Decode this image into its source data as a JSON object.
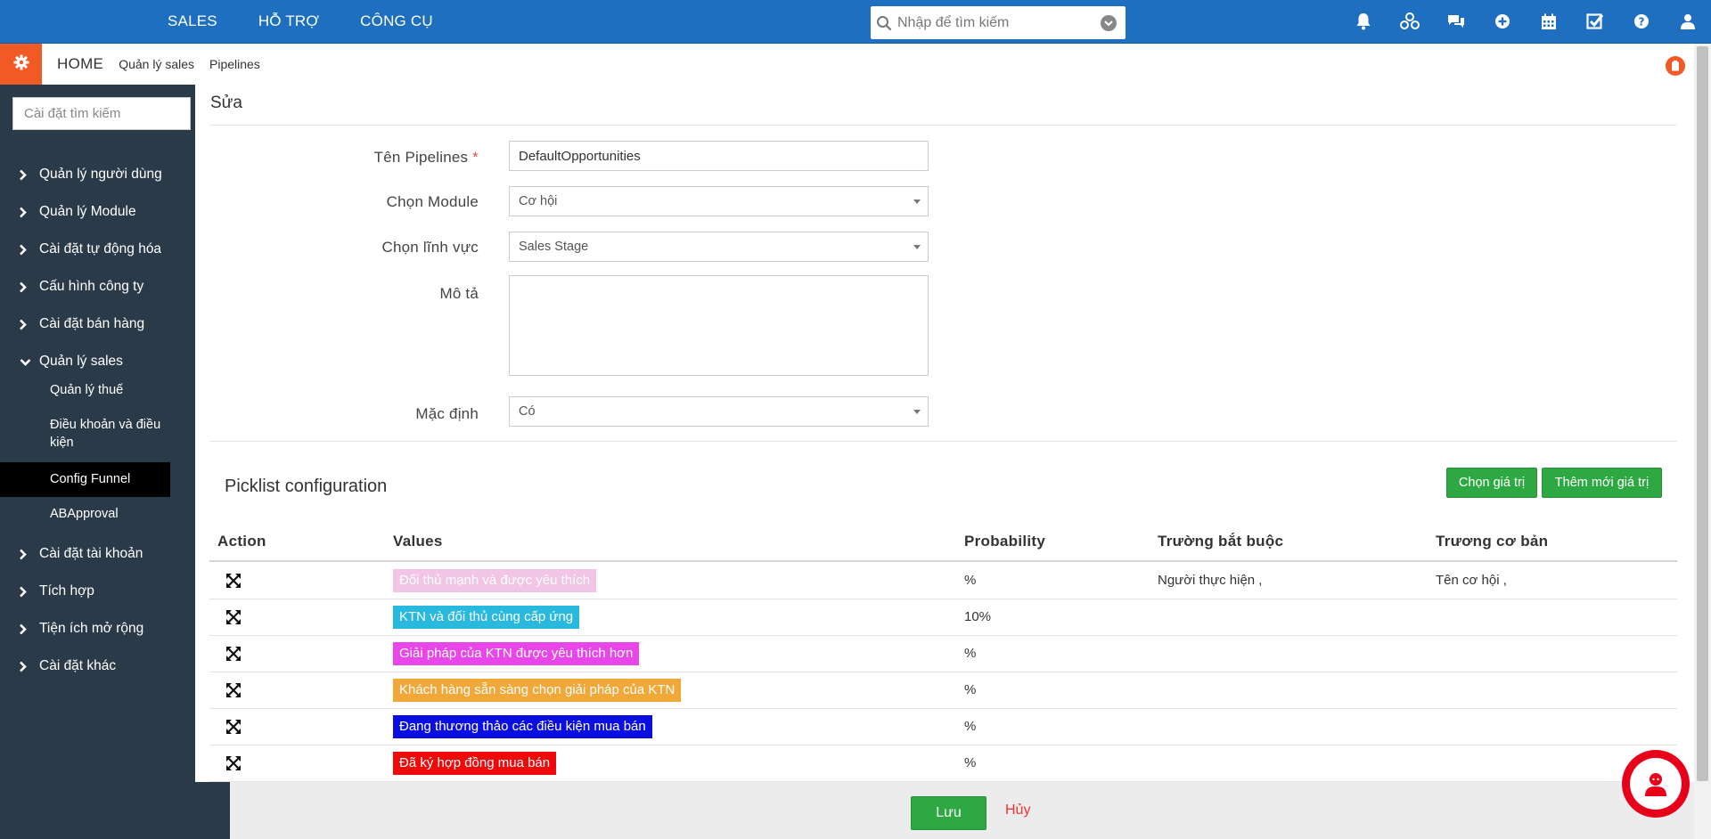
{
  "topnav": {
    "menu": [
      "SALES",
      "HỖ TRỢ",
      "CÔNG CỤ"
    ],
    "search_placeholder": "Nhập để tìm kiếm",
    "icons": [
      "bell-icon",
      "network-icon",
      "chat-icon",
      "plus-circle-icon",
      "calendar-icon",
      "checkbox-icon",
      "help-icon",
      "user-icon"
    ]
  },
  "breadcrumb": {
    "home": "HOME",
    "items": [
      "Quản lý sales",
      "Pipelines"
    ]
  },
  "sidebar": {
    "search_placeholder": "Cài đặt tìm kiếm",
    "items": [
      "Quản lý người dùng",
      "Quản lý Module",
      "Cài đặt tự động hóa",
      "Cấu hình công ty",
      "Cài đặt bán hàng",
      "Quản lý sales",
      "Cài đặt tài khoản",
      "Tích hợp",
      "Tiện ích mở rộng",
      "Cài đặt khác"
    ],
    "sub_items": [
      "Quản lý thuế",
      "Điều khoản và điều kiện",
      "Config Funnel",
      "ABApproval"
    ],
    "active_sub": "Config Funnel"
  },
  "form": {
    "title": "Sửa",
    "name_label": "Tên Pipelines",
    "required_mark": "*",
    "name_value": "DefaultOpportunities",
    "module_label": "Chọn Module",
    "module_value": "Cơ hội",
    "field_label": "Chọn lĩnh vực",
    "field_value": "Sales Stage",
    "desc_label": "Mô tả",
    "desc_value": "",
    "default_label": "Mặc định",
    "default_value": "Có"
  },
  "picklist": {
    "title": "Picklist configuration",
    "choose_button": "Chọn giá trị",
    "add_button": "Thêm mới giá trị",
    "headers": [
      "Action",
      "Values",
      "Probability",
      "Trường bắt buộc",
      "Trương cơ bản"
    ],
    "rows": [
      {
        "value": "Đối thủ mạnh và được yêu thích",
        "color": "#f2c4e6",
        "probability": "%",
        "required": "Người thực hiện ,",
        "basic": "Tên cơ hội ,"
      },
      {
        "value": "KTN và đối thủ cùng cấp ứng",
        "color": "#29b8de",
        "probability": "10%",
        "required": "",
        "basic": ""
      },
      {
        "value": "Giải pháp của KTN được yêu thích hơn",
        "color": "#e846e8",
        "probability": "%",
        "required": "",
        "basic": ""
      },
      {
        "value": "Khách hàng sẵn sàng chọn giải pháp của KTN",
        "color": "#f2a838",
        "probability": "%",
        "required": "",
        "basic": ""
      },
      {
        "value": "Đang thương thảo các điều kiện mua bán",
        "color": "#0a0ee0",
        "probability": "%",
        "required": "",
        "basic": ""
      },
      {
        "value": "Đã ký hợp đồng mua bán",
        "color": "#ee0a0a",
        "probability": "%",
        "required": "",
        "basic": ""
      }
    ]
  },
  "footer": {
    "save_label": "Lưu",
    "cancel_label": "Hủy"
  }
}
